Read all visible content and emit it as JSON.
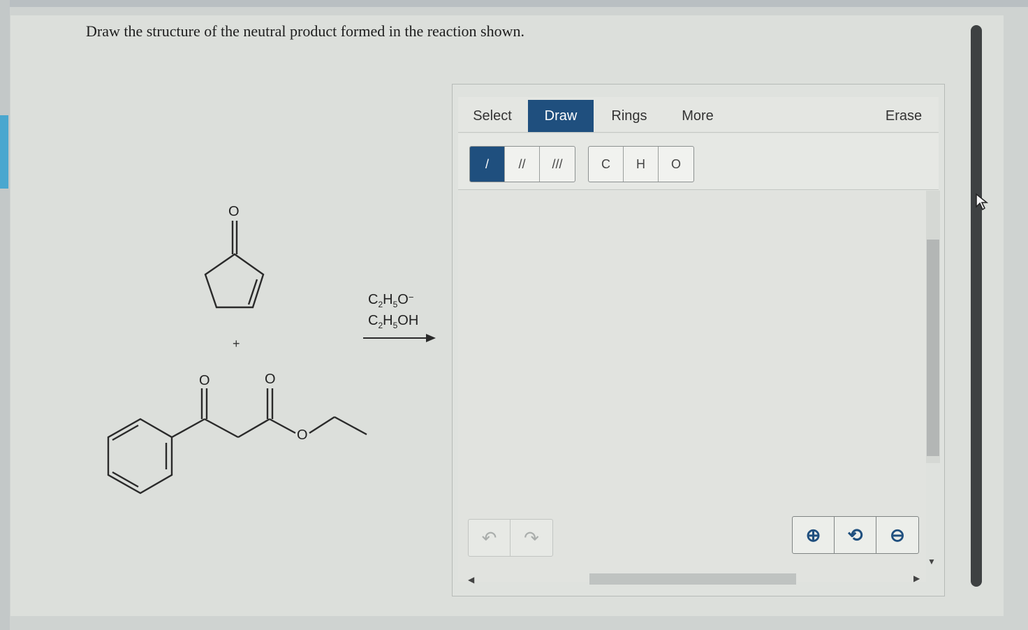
{
  "question": "Draw the structure of the neutral product formed in the reaction shown.",
  "reaction": {
    "reactant1_atom": "O",
    "plus": "+",
    "reactant2_atoms": [
      "O",
      "O",
      "O"
    ],
    "reagent_top": {
      "main": "C",
      "sub1": "2",
      "mid": "H",
      "sub2": "5",
      "end": "O",
      "charge": "−"
    },
    "reagent_bottom": {
      "main": "C",
      "sub1": "2",
      "mid": "H",
      "sub2": "5",
      "end": "OH"
    }
  },
  "editor": {
    "tabs": [
      {
        "label": "Select"
      },
      {
        "label": "Draw"
      },
      {
        "label": "Rings"
      },
      {
        "label": "More"
      },
      {
        "label": "Erase"
      }
    ],
    "active_tab": "Draw",
    "bond_buttons": [
      "/",
      "//",
      "///"
    ],
    "atom_buttons": [
      "C",
      "H",
      "O"
    ],
    "undo_icon": "undo-icon",
    "redo_icon": "redo-icon",
    "zoom_buttons": [
      "zoom-in-icon",
      "zoom-reset-icon",
      "zoom-out-icon"
    ]
  },
  "colors": {
    "accent": "#1f4f7e",
    "page_bg": "#dcdfdb"
  }
}
